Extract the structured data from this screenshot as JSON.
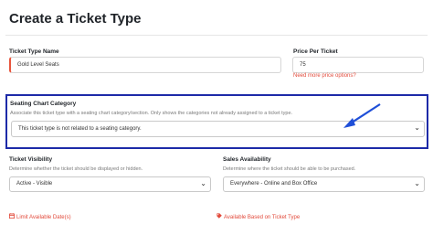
{
  "page": {
    "title": "Create a Ticket Type"
  },
  "ticket_type_name": {
    "label": "Ticket Type Name",
    "value": "Gold Level Seats"
  },
  "price_per_ticket": {
    "label": "Price Per Ticket",
    "value": "75",
    "more_link": "Need more price options?"
  },
  "seating_chart": {
    "label": "Seating Chart Category",
    "description": "Associate this ticket type with a seating chart category/section. Only shows the categories not already assigned to a ticket type.",
    "selected": "This ticket type is not related to a seating category."
  },
  "ticket_visibility": {
    "label": "Ticket Visibility",
    "description": "Determine whether the ticket should be displayed or hidden.",
    "selected": "Active - Visible"
  },
  "sales_availability": {
    "label": "Sales Availability",
    "description": "Determine where the ticket should be able to be purchased.",
    "selected": "Everywhere - Online and Box Office"
  },
  "footer_links": {
    "limit_dates": "Limit Available Date(s)",
    "based_on_ticket_type": "Available Based on Ticket Type"
  },
  "colors": {
    "highlight_box": "#1d2aa8",
    "arrow": "#1f4fd8",
    "accent_red": "#e24a3b"
  },
  "icons": {
    "select_chevron": "chevron-down-icon",
    "calendar": "calendar-icon",
    "tag": "tag-icon",
    "arrow": "annotation-arrow"
  }
}
